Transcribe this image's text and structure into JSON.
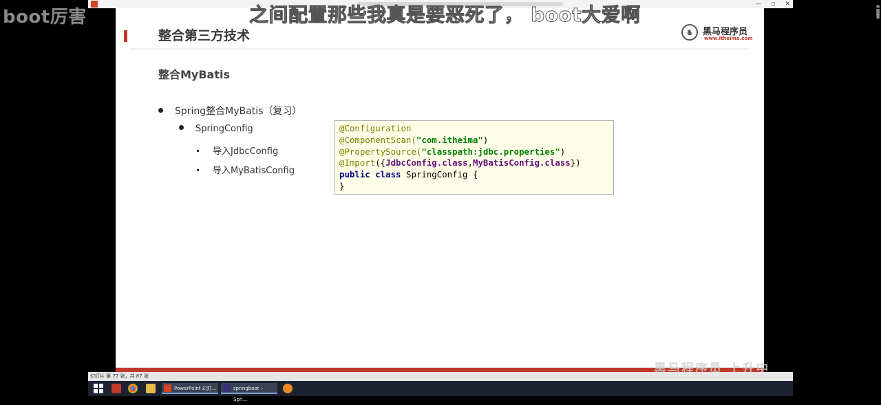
{
  "overlay": {
    "left_text": "boot厉害",
    "right_text": "i",
    "subtitle": "之间配置那些我真是要恶死了，  boot大爱啊"
  },
  "window": {
    "buttons": [
      "—",
      "▫",
      "✕"
    ]
  },
  "slide": {
    "title": "整合第三方技术",
    "logo_text": "黑马程序员",
    "logo_url": "www.itheima.com",
    "section_heading": "整合MyBatis",
    "bullets": {
      "level1": "Spring整合MyBatis（复习）",
      "level2": "SpringConfig",
      "level3": [
        "导入JdbcConfig",
        "导入MyBatisConfig"
      ]
    },
    "code": {
      "line1": "@Configuration",
      "line2_ann": "@ComponentScan(",
      "line2_str": "\"com.itheima\"",
      "line2_end": ")",
      "line3_ann": "@PropertySource(",
      "line3_str": "\"classpath:jdbc.properties\"",
      "line3_end": ")",
      "line4_ann": "@Import",
      "line4_open": "({",
      "line4_c1": "JdbcConfig",
      "line4_kw1": ".class",
      "line4_comma": ",",
      "line4_c2": "MyBatisConfig",
      "line4_kw2": ".class",
      "line4_close": "})",
      "line5_kw": "public class",
      "line5_rest": " SpringConfig {",
      "line6": "}"
    }
  },
  "statusbar": {
    "text": "幻灯片 第 77 张，共 87 张"
  },
  "taskbar": {
    "apps": [
      {
        "label": "PowerPoint 幻灯...",
        "color": "#d04423"
      },
      {
        "label": "springboot – Spri...",
        "color": "#3b2f7a"
      }
    ]
  },
  "watermark": "黑马程序员 上升中",
  "colors": {
    "accent": "#c0392b",
    "code_bg": "#fefee8"
  }
}
